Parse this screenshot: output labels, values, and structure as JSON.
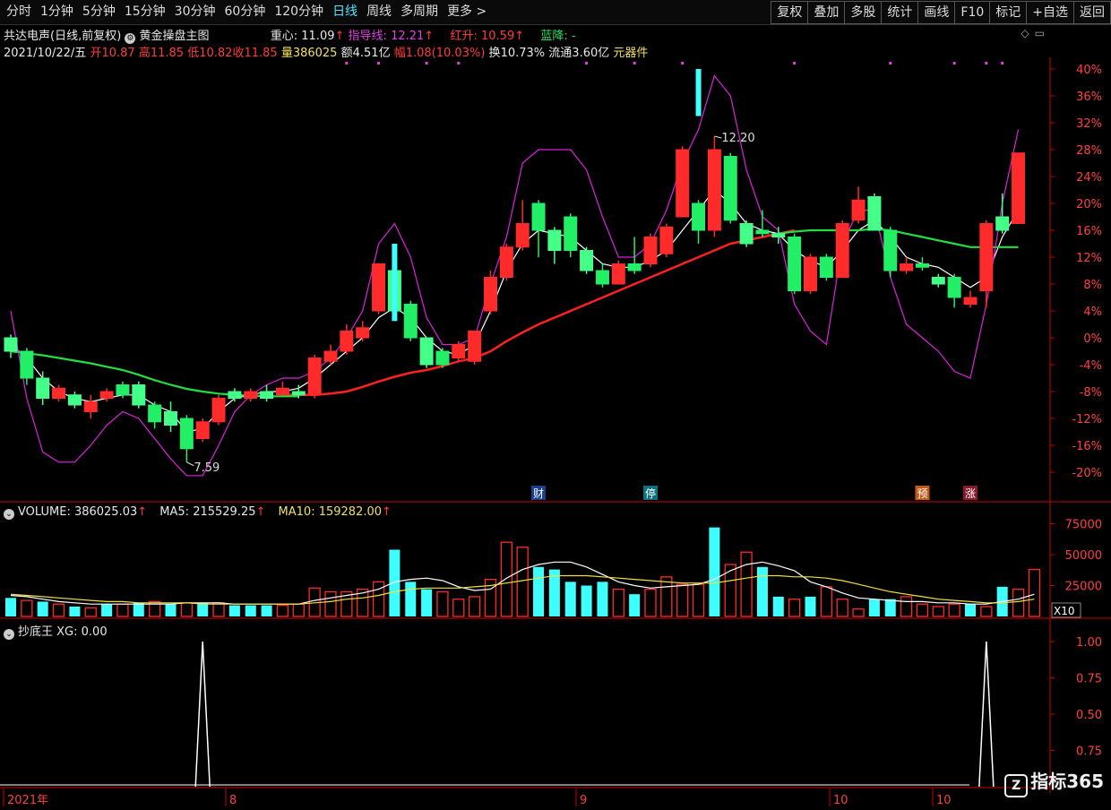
{
  "toolbar": {
    "periods": [
      "分时",
      "1分钟",
      "5分钟",
      "15分钟",
      "30分钟",
      "60分钟",
      "120分钟",
      "日线",
      "周线",
      "多周期",
      "更多 >"
    ],
    "active_period": "日线",
    "tools": [
      "复权",
      "叠加",
      "多股",
      "统计",
      "画线",
      "F10",
      "标记",
      "+自选",
      "返回"
    ]
  },
  "header": {
    "stock_name": "共达电声",
    "fq": "(日线,前复权)",
    "indicator": "黄金操盘主图",
    "zhongxin_label": "重心:",
    "zhongxin_value": "11.09",
    "zhidao_label": "指导线:",
    "zhidao_value": "12.21",
    "hongsheng_label": "红升:",
    "hongsheng_value": "10.59",
    "lanjiang_label": "蓝降:",
    "lanjiang_value": "-",
    "date": "2021/10/22/五",
    "open_label": "开",
    "open": "10.87",
    "high_label": "高",
    "high": "11.85",
    "low_label": "低",
    "low": "10.82",
    "close_label": "收",
    "close": "11.85",
    "vol_label": "量",
    "vol": "386025",
    "amount_label": "额",
    "amount": "4.51亿",
    "change_label": "幅",
    "change": "1.08(10.03%)",
    "turnover_label": "换",
    "turnover": "10.73%",
    "float_label": "流通",
    "float": "3.60亿",
    "sector": "元器件"
  },
  "markers": {
    "high": "12.20",
    "low": "7.59",
    "cai": "财",
    "ting": "停",
    "yu": "预",
    "zhang": "涨"
  },
  "volume_header": {
    "vol": "VOLUME: 386025.03",
    "ma5": "MA5: 215529.25",
    "ma10": "MA10: 159282.00"
  },
  "xg_header": {
    "title": "抄底王",
    "xg": "XG: 0.00"
  },
  "x_labels": [
    "2021年",
    "8",
    "9",
    "10",
    "10"
  ],
  "watermark": "指标365",
  "colors": {
    "up": "#ff2a2a",
    "down": "#3dffff",
    "bg": "#000000",
    "axis": "#cc0000"
  },
  "chart_data": [
    {
      "type": "candlestick",
      "title": "黄金操盘主图",
      "ylabel": "",
      "y_ticks": [
        "40%",
        "36%",
        "32%",
        "28%",
        "24%",
        "20%",
        "16%",
        "12%",
        "8%",
        "4%",
        "0%",
        "-4%",
        "-8%",
        "-12%",
        "-16%",
        "-20%"
      ],
      "ylim_pct": [
        -20,
        40
      ],
      "candles": [
        {
          "o": 0,
          "c": -2,
          "h": 0.5,
          "l": -3
        },
        {
          "o": -2,
          "c": -6,
          "h": -1.5,
          "l": -7
        },
        {
          "o": -6,
          "c": -9,
          "h": -5,
          "l": -10
        },
        {
          "o": -9,
          "c": -7.5,
          "h": -7,
          "l": -9.5
        },
        {
          "o": -8.5,
          "c": -10,
          "h": -8,
          "l": -10.5
        },
        {
          "o": -11,
          "c": -9.5,
          "h": -8.5,
          "l": -12
        },
        {
          "o": -9,
          "c": -8,
          "h": -7.5,
          "l": -9.5
        },
        {
          "o": -7,
          "c": -8.5,
          "h": -6.5,
          "l": -9
        },
        {
          "o": -7,
          "c": -10,
          "h": -6.5,
          "l": -10.5
        },
        {
          "o": -10,
          "c": -12.5,
          "h": -9.5,
          "l": -13.5
        },
        {
          "o": -11,
          "c": -13,
          "h": -9.5,
          "l": -14
        },
        {
          "o": -12,
          "c": -16.5,
          "h": -11.5,
          "l": -18.5
        },
        {
          "o": -15,
          "c": -12.5,
          "h": -12,
          "l": -15.5
        },
        {
          "o": -12.5,
          "c": -9,
          "h": -8.5,
          "l": -13
        },
        {
          "o": -8,
          "c": -9,
          "h": -7.5,
          "l": -9.5
        },
        {
          "o": -9,
          "c": -8,
          "h": -7.5,
          "l": -9.5
        },
        {
          "o": -8,
          "c": -9,
          "h": -7,
          "l": -9.5
        },
        {
          "o": -8.5,
          "c": -7.5,
          "h": -6.5,
          "l": -8.5
        },
        {
          "o": -8,
          "c": -8.5,
          "h": -7,
          "l": -9
        },
        {
          "o": -8.5,
          "c": -3,
          "h": -2.5,
          "l": -9
        },
        {
          "o": -3.5,
          "c": -2,
          "h": -1,
          "l": -4
        },
        {
          "o": -2,
          "c": 1,
          "h": 2,
          "l": -2.5
        },
        {
          "o": 0,
          "c": 1.5,
          "h": 2.5,
          "l": -0.5
        },
        {
          "o": 4,
          "c": 11,
          "h": 11,
          "l": 3.5
        },
        {
          "o": 10,
          "c": 4,
          "h": 10.5,
          "l": 2.5
        },
        {
          "o": 5,
          "c": 0,
          "h": 5.5,
          "l": -0.5
        },
        {
          "o": 0,
          "c": -4,
          "h": 0,
          "l": -4.5
        },
        {
          "o": -2,
          "c": -4,
          "h": -1.5,
          "l": -4.5
        },
        {
          "o": -3,
          "c": -1,
          "h": -0.5,
          "l": -3.5
        },
        {
          "o": -3.5,
          "c": 1,
          "h": 1,
          "l": -4
        },
        {
          "o": 4,
          "c": 9,
          "h": 10,
          "l": 3.5
        },
        {
          "o": 9,
          "c": 13.5,
          "h": 14,
          "l": 8.5
        },
        {
          "o": 13.5,
          "c": 17,
          "h": 20.5,
          "l": 13
        },
        {
          "o": 20,
          "c": 16,
          "h": 20.5,
          "l": 12
        },
        {
          "o": 16,
          "c": 13,
          "h": 16.5,
          "l": 11
        },
        {
          "o": 18,
          "c": 13,
          "h": 18.5,
          "l": 12
        },
        {
          "o": 13,
          "c": 10,
          "h": 13.5,
          "l": 9.5
        },
        {
          "o": 10,
          "c": 8,
          "h": 11,
          "l": 7.5
        },
        {
          "o": 8,
          "c": 11,
          "h": 11.5,
          "l": 8
        },
        {
          "o": 11,
          "c": 10,
          "h": 15,
          "l": 9.5
        },
        {
          "o": 11,
          "c": 15,
          "h": 15.5,
          "l": 10.5
        },
        {
          "o": 12.5,
          "c": 16.5,
          "h": 17,
          "l": 12
        },
        {
          "o": 18,
          "c": 28,
          "h": 28.5,
          "l": 18
        },
        {
          "o": 20,
          "c": 16,
          "h": 20.5,
          "l": 14
        },
        {
          "o": 16,
          "c": 28,
          "h": 30,
          "l": 15
        },
        {
          "o": 27,
          "c": 17.5,
          "h": 27.5,
          "l": 17
        },
        {
          "o": 17,
          "c": 14,
          "h": 17.5,
          "l": 13.5
        },
        {
          "o": 16,
          "c": 15.5,
          "h": 19,
          "l": 15
        },
        {
          "o": 15.5,
          "c": 15,
          "h": 16.5,
          "l": 14
        },
        {
          "o": 15,
          "c": 7,
          "h": 15.5,
          "l": 6.5
        },
        {
          "o": 7,
          "c": 12,
          "h": 12.5,
          "l": 6.5
        },
        {
          "o": 12,
          "c": 9,
          "h": 12.5,
          "l": 8.5
        },
        {
          "o": 9,
          "c": 17,
          "h": 17.5,
          "l": 9
        },
        {
          "o": 17.5,
          "c": 20.5,
          "h": 22.5,
          "l": 17
        },
        {
          "o": 21,
          "c": 16,
          "h": 21.5,
          "l": 16
        },
        {
          "o": 16,
          "c": 10,
          "h": 16.5,
          "l": 9
        },
        {
          "o": 10,
          "c": 11,
          "h": 12,
          "l": 9.5
        },
        {
          "o": 11,
          "c": 10.5,
          "h": 12,
          "l": 10
        },
        {
          "o": 9,
          "c": 8,
          "h": 9.5,
          "l": 7.5
        },
        {
          "o": 9,
          "c": 6,
          "h": 9.5,
          "l": 4.5
        },
        {
          "o": 5,
          "c": 6,
          "h": 7,
          "l": 4.5
        },
        {
          "o": 7,
          "c": 17,
          "h": 17.5,
          "l": 4.5
        },
        {
          "o": 18,
          "c": 16,
          "h": 21.5,
          "l": 15.5
        },
        {
          "o": 17,
          "c": 27.5,
          "h": 27.5,
          "l": 17
        }
      ],
      "series": [
        {
          "name": "重心",
          "color": "#ffffff",
          "values": [
            -1,
            -3,
            -6,
            -8,
            -9,
            -9.5,
            -9,
            -8.5,
            -8.5,
            -10,
            -11,
            -14,
            -13.5,
            -11,
            -9,
            -8.5,
            -8,
            -8,
            -7.5,
            -6,
            -4,
            -2,
            0,
            3,
            4.5,
            3,
            0,
            -2,
            -2.5,
            -1,
            4,
            10,
            14,
            16,
            15.5,
            15,
            13,
            11,
            10.5,
            10.5,
            11.5,
            13,
            16,
            19,
            22,
            20,
            17,
            16,
            15.5,
            13,
            11.5,
            10.5,
            13,
            16,
            17.5,
            15,
            12,
            11,
            10.5,
            9,
            7.5,
            9,
            15,
            19
          ]
        },
        {
          "name": "黄金线",
          "color": "#ff2020",
          "values": [
            null,
            null,
            null,
            null,
            null,
            null,
            null,
            null,
            null,
            null,
            null,
            null,
            null,
            null,
            null,
            null,
            null,
            -8.5,
            -8.5,
            -8.5,
            -8.3,
            -8,
            -7.3,
            -6.5,
            -5.8,
            -5.2,
            -4.8,
            -4.2,
            -3.5,
            -3,
            -2,
            -0.5,
            0.8,
            2,
            3,
            4,
            5,
            6,
            7,
            8,
            9,
            10,
            11,
            12,
            13,
            14,
            14.5,
            15,
            15.5,
            16
          ]
        },
        {
          "name": "绿线",
          "color": "#22dd44",
          "values": [
            -2,
            -2.3,
            -2.6,
            -3,
            -3.4,
            -3.8,
            -4.3,
            -4.8,
            -5.5,
            -6.3,
            -7,
            -7.6,
            -8,
            -8.3,
            -8.5,
            -8.6,
            -8.7,
            -8.7,
            -8.7,
            null,
            null,
            null,
            null,
            null,
            null,
            null,
            null,
            null,
            null,
            null,
            null,
            null,
            null,
            null,
            null,
            null,
            null,
            null,
            null,
            null,
            null,
            null,
            null,
            null,
            null,
            null,
            null,
            null,
            15.5,
            15.8,
            16,
            16,
            16,
            16,
            16.2,
            16,
            15.5,
            15,
            14.5,
            14,
            13.5,
            13.5,
            13.5,
            13.5
          ]
        },
        {
          "name": "通道",
          "color": "#dd22dd",
          "values": [
            4,
            -9,
            -17,
            -18.5,
            -18.5,
            -16,
            -13,
            -11,
            -12,
            -15,
            -18,
            -20.5,
            -20.5,
            -16,
            -11,
            -8.5,
            -7,
            -6,
            -6,
            -5,
            -3,
            0,
            4,
            14,
            17,
            12,
            3,
            -1,
            -1,
            0,
            8,
            15,
            26,
            28,
            28,
            28,
            25,
            18,
            12,
            12,
            14,
            19,
            26,
            31,
            39,
            36,
            25,
            18,
            16,
            5,
            1,
            -1,
            14,
            19,
            19,
            9,
            2,
            0,
            -2,
            -5,
            -6,
            5,
            20,
            31
          ]
        }
      ]
    },
    {
      "type": "bar",
      "title": "VOLUME",
      "y_ticks": [
        "75000",
        "50000",
        "25000"
      ],
      "unit": "X10",
      "values": [
        15,
        13,
        12,
        10,
        8,
        7,
        10,
        10,
        11,
        12,
        10,
        11,
        11,
        11,
        9,
        9,
        9,
        9,
        10,
        23,
        20,
        20,
        22,
        28,
        54,
        28,
        22,
        20,
        14,
        16,
        30,
        60,
        56,
        40,
        38,
        28,
        25,
        28,
        22,
        18,
        22,
        32,
        26,
        26,
        72,
        42,
        52,
        40,
        16,
        14,
        16,
        24,
        14,
        6,
        14,
        14,
        16,
        10,
        8,
        10,
        10,
        8,
        24,
        22,
        38
      ],
      "up": [
        0,
        1,
        0,
        1,
        0,
        1,
        0,
        1,
        0,
        1,
        0,
        1,
        0,
        1,
        0,
        0,
        0,
        1,
        1,
        1,
        1,
        1,
        1,
        1,
        0,
        0,
        0,
        1,
        1,
        1,
        1,
        1,
        1,
        0,
        0,
        0,
        0,
        0,
        1,
        0,
        1,
        1,
        1,
        1,
        0,
        1,
        1,
        0,
        0,
        1,
        0,
        1,
        1,
        1,
        0,
        0,
        1,
        1,
        1,
        1,
        0,
        1,
        0,
        1,
        1
      ],
      "series": [
        {
          "name": "MA5",
          "color": "#ffffff",
          "values": [
            17,
            16,
            14,
            12,
            11,
            10,
            10,
            10,
            10,
            10,
            10,
            11,
            11,
            11,
            10,
            10,
            10,
            10,
            10,
            13,
            15,
            17,
            19,
            22,
            28,
            30,
            31,
            29,
            24,
            21,
            22,
            31,
            38,
            42,
            44,
            44,
            40,
            34,
            28,
            25,
            23,
            24,
            25,
            26,
            30,
            37,
            42,
            44,
            41,
            37,
            28,
            24,
            19,
            15,
            14,
            13,
            12,
            12,
            11,
            11,
            10,
            10,
            12,
            14,
            18
          ]
        },
        {
          "name": "MA10",
          "color": "#f0e040",
          "values": [
            18,
            17,
            16,
            15,
            14,
            13,
            12,
            12,
            11,
            11,
            11,
            11,
            10,
            10,
            10,
            10,
            10,
            10,
            10,
            11,
            12,
            14,
            15,
            17,
            20,
            22,
            23,
            23,
            23,
            24,
            25,
            27,
            29,
            31,
            33,
            33,
            33,
            32,
            31,
            30,
            29,
            28,
            27,
            27,
            27,
            29,
            31,
            33,
            33,
            32,
            32,
            31,
            29,
            26,
            23,
            20,
            18,
            16,
            14,
            13,
            12,
            11,
            11,
            12,
            14
          ]
        }
      ]
    },
    {
      "type": "line",
      "title": "抄底王",
      "y_ticks": [
        "1.00",
        "0.75",
        "0.50",
        "0.75"
      ],
      "series": [
        {
          "name": "XG",
          "color": "#ffffff",
          "spikes": [
            12,
            61
          ]
        }
      ]
    }
  ]
}
